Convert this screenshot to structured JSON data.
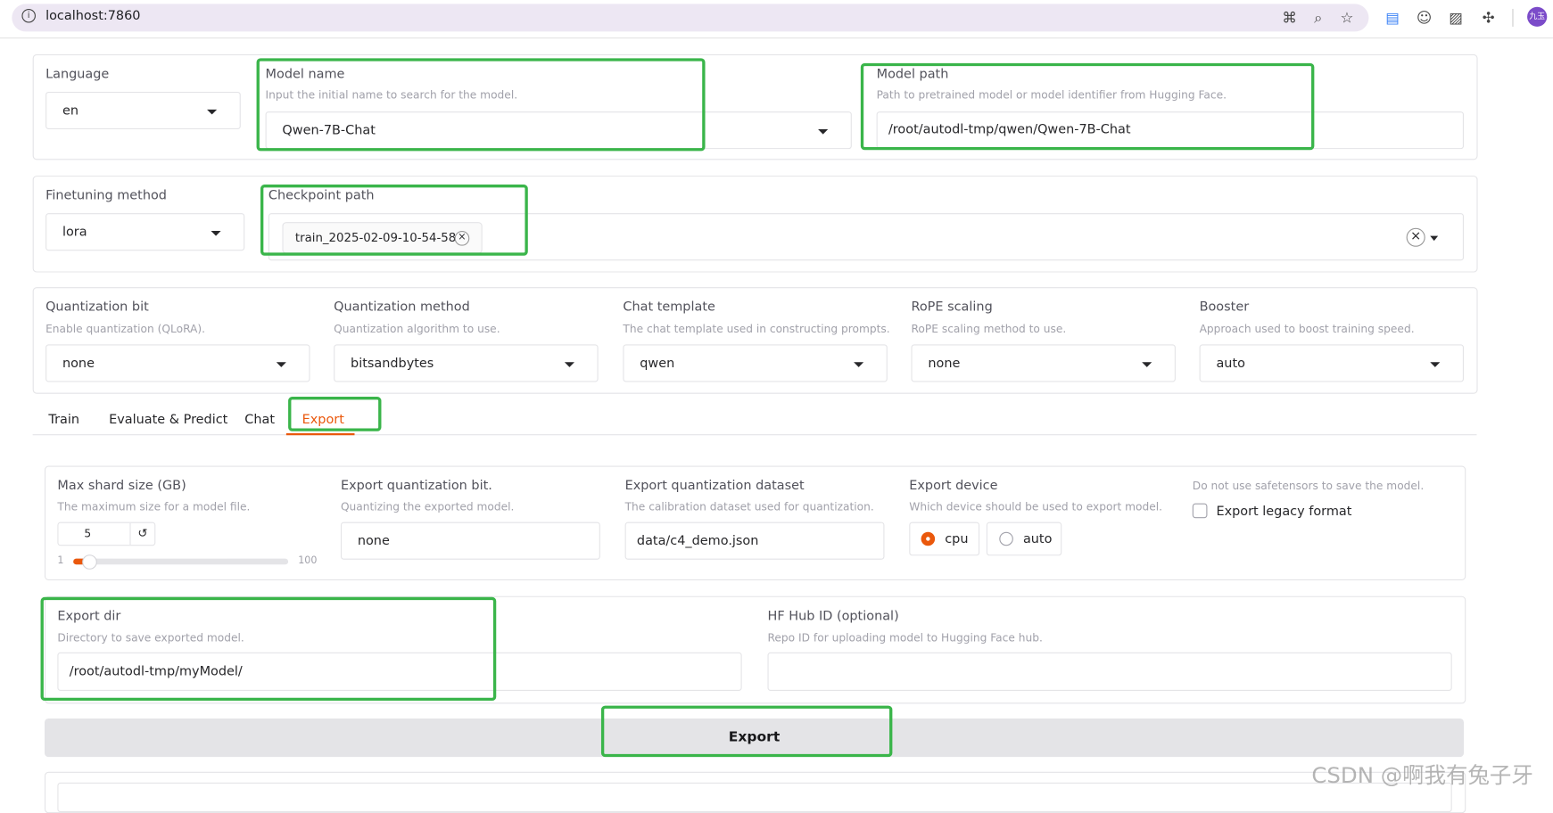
{
  "browser": {
    "url": "localhost:7860",
    "profile_text": "九玉"
  },
  "top": {
    "language": {
      "label": "Language",
      "value": "en"
    },
    "model_name": {
      "label": "Model name",
      "info": "Input the initial name to search for the model.",
      "value": "Qwen-7B-Chat"
    },
    "model_path": {
      "label": "Model path",
      "info": "Path to pretrained model or model identifier from Hugging Face.",
      "value": "/root/autodl-tmp/qwen/Qwen-7B-Chat"
    }
  },
  "finetune": {
    "method": {
      "label": "Finetuning method",
      "value": "lora"
    },
    "checkpoint": {
      "label": "Checkpoint path",
      "tag": "train_2025-02-09-10-54-58",
      "tag_close": "×",
      "clear": "×"
    }
  },
  "advanced": [
    {
      "label": "Quantization bit",
      "info": "Enable quantization (QLoRA).",
      "value": "none"
    },
    {
      "label": "Quantization method",
      "info": "Quantization algorithm to use.",
      "value": "bitsandbytes"
    },
    {
      "label": "Chat template",
      "info": "The chat template used in constructing prompts.",
      "value": "qwen"
    },
    {
      "label": "RoPE scaling",
      "info": "RoPE scaling method to use.",
      "value": "none"
    },
    {
      "label": "Booster",
      "info": "Approach used to boost training speed.",
      "value": "auto"
    }
  ],
  "tabs": [
    "Train",
    "Evaluate & Predict",
    "Chat",
    "Export"
  ],
  "export": {
    "shard": {
      "label": "Max shard size (GB)",
      "info": "The maximum size for a model file.",
      "value": "5",
      "reset": "↺",
      "min": "1",
      "max": "100",
      "level": 0.04
    },
    "quant_bit": {
      "label": "Export quantization bit.",
      "info": "Quantizing the exported model.",
      "value": "none"
    },
    "quant_dataset": {
      "label": "Export quantization dataset",
      "info": "The calibration dataset used for quantization.",
      "value": "data/c4_demo.json"
    },
    "device": {
      "label": "Export device",
      "info": "Which device should be used to export model.",
      "options": [
        "cpu",
        "auto"
      ],
      "selected": "cpu"
    },
    "legacy": {
      "info": "Do not use safetensors to save the model.",
      "label": "Export legacy format",
      "checked": false
    },
    "dir": {
      "label": "Export dir",
      "info": "Directory to save exported model.",
      "value": "/root/autodl-tmp/myModel/"
    },
    "hub": {
      "label": "HF Hub ID (optional)",
      "info": "Repo ID for uploading model to Hugging Face hub.",
      "value": ""
    },
    "button": "Export"
  },
  "watermark": "CSDN @啊我有兔子牙",
  "colors": {
    "accent": "#ea580c",
    "highlight": "#3ab54a",
    "button_bg": "#e4e4e7"
  }
}
